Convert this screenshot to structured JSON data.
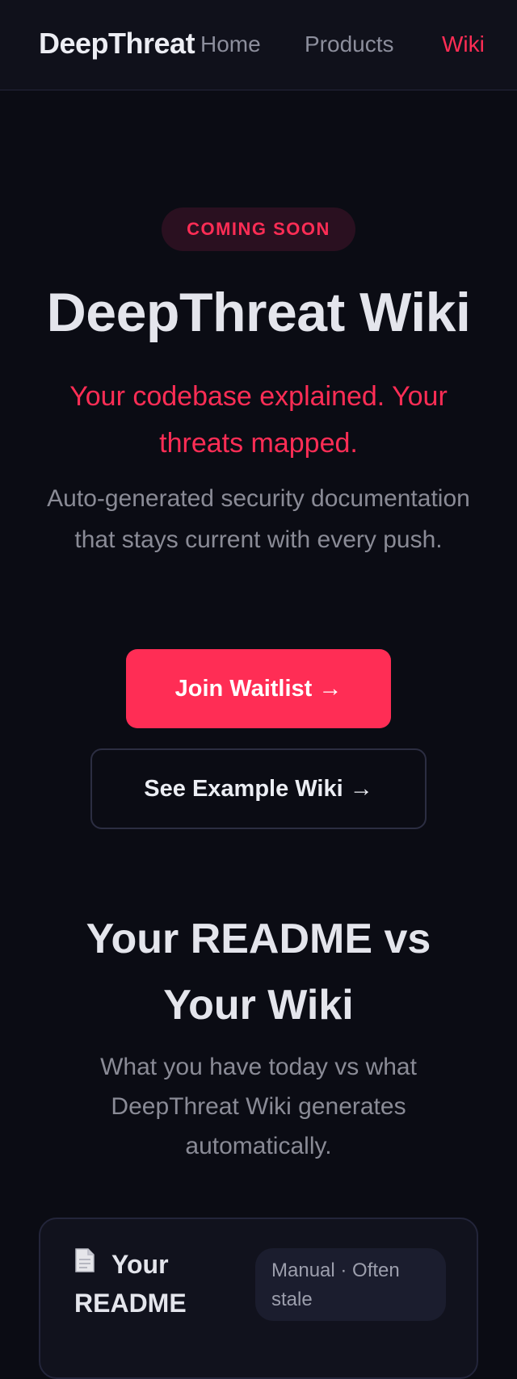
{
  "nav": {
    "brand": "DeepThreat",
    "links": [
      {
        "label": "Home",
        "active": false
      },
      {
        "label": "Products",
        "active": false
      },
      {
        "label": "Wiki",
        "active": true
      }
    ]
  },
  "hero": {
    "badge": "COMING SOON",
    "title": "DeepThreat Wiki",
    "tagline": "Your codebase explained. Your threats mapped.",
    "description": "Auto-generated security documentation that stays current with every push.",
    "primary_button": "Join Waitlist →",
    "secondary_button": "See Example Wiki →"
  },
  "comparison": {
    "title": "Your README vs Your Wiki",
    "description": "What you have today vs what DeepThreat Wiki generates automatically.",
    "card": {
      "icon": "document-icon",
      "title_line1": "Your",
      "title_line2": "README",
      "pill": "Manual · Often stale"
    }
  },
  "colors": {
    "background": "#0b0c14",
    "accent": "#ff2d55",
    "muted_text": "#8a8b96"
  }
}
